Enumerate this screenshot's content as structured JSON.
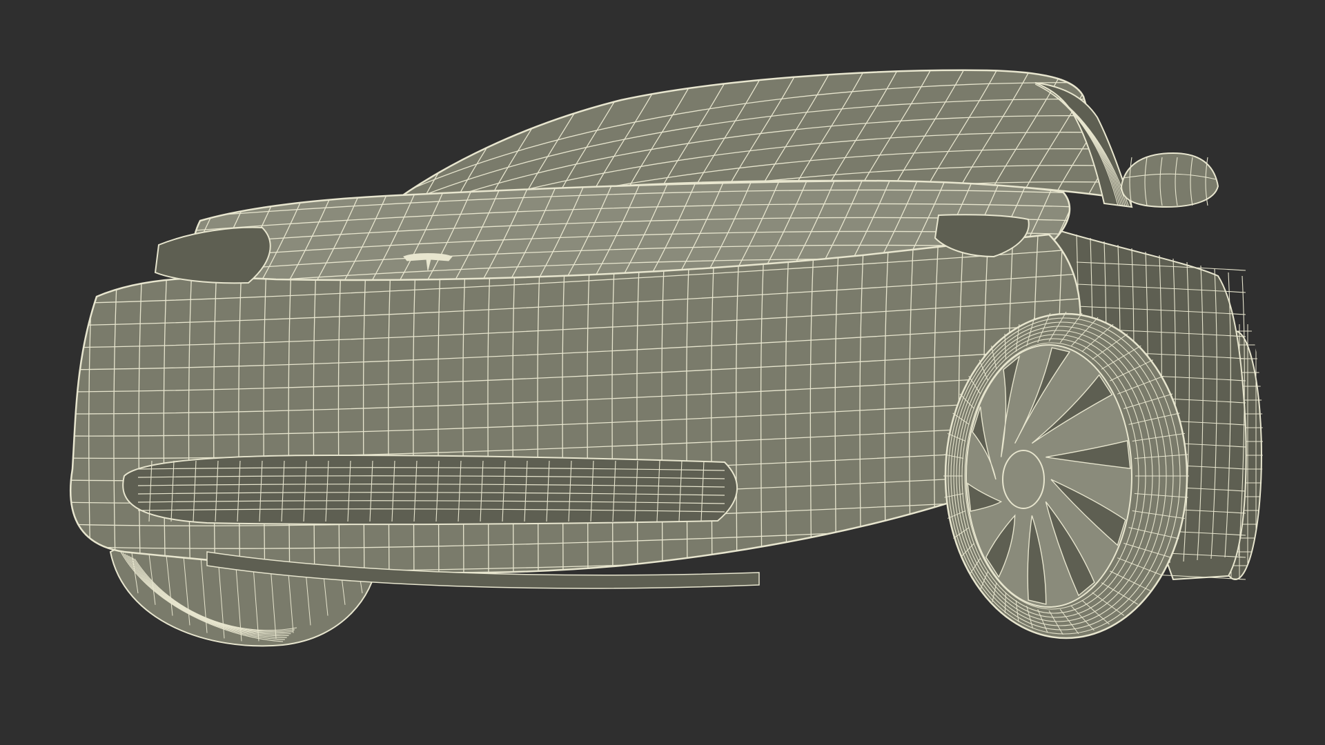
{
  "scene": {
    "subject": "car-wireframe-render",
    "colors": {
      "background": "#2f2f2f",
      "body_fill": "#7a7b6b",
      "body_fill_light": "#8a8b7b",
      "body_fill_dark": "#5e5f52",
      "wire": "#e8e6cf",
      "shadow": "#1e1e1e"
    }
  }
}
